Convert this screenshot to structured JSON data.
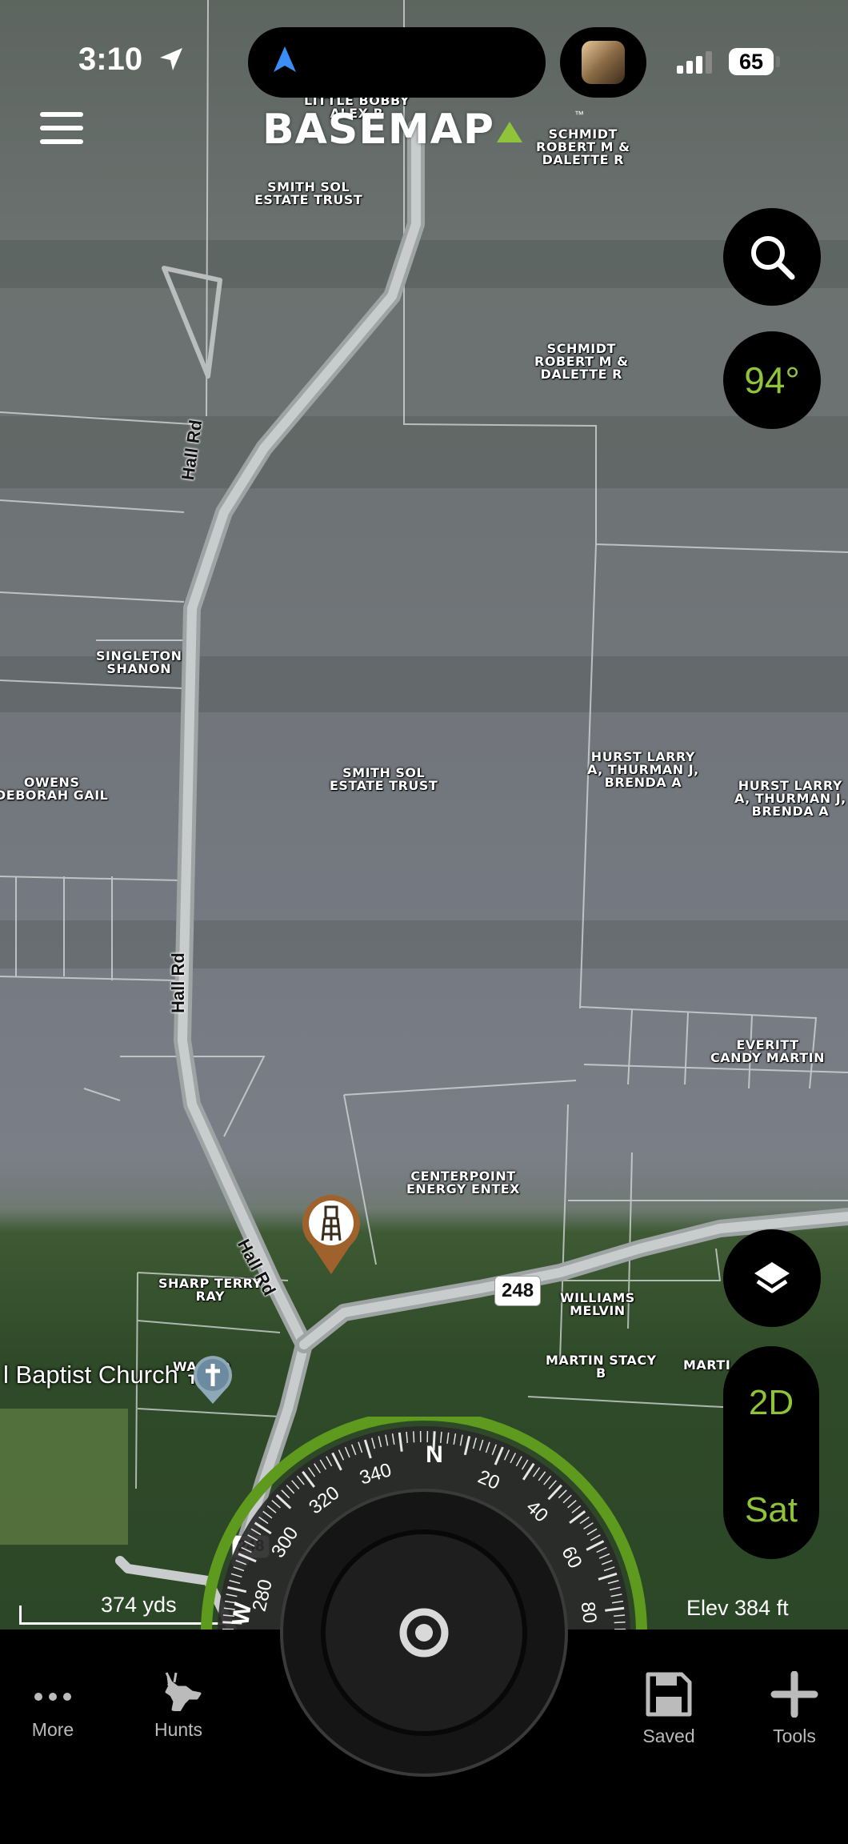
{
  "status_bar": {
    "time": "3:10",
    "battery": "65"
  },
  "header": {
    "logo_text": "BASEMAP",
    "logo_tm": "™"
  },
  "weather": {
    "temperature": "94°"
  },
  "map": {
    "roads": {
      "hall_rd_1": "Hall Rd",
      "hall_rd_2": "Hall Rd",
      "hall_rd_3": "Hall Rd",
      "route_248_a": "248",
      "route_248_b": "248"
    },
    "parcels": {
      "little_bobby": "LITTLE BOBBY\nALEX R",
      "schmidt_top": "SCHMIDT\nROBERT M &\nDALETTE R",
      "smith_top": "SMITH SOL\nESTATE TRUST",
      "schmidt_mid": "SCHMIDT\nROBERT M &\nDALETTE R",
      "singleton": "SINGLETON\nSHANON",
      "smith_mid": "SMITH SOL\nESTATE TRUST",
      "owens": "OWENS\nDEBORAH GAIL",
      "hurst_1": "HURST LARRY\nA, THURMAN J,\nBRENDA A",
      "hurst_2": "HURST LARRY\nA, THURMAN J,\nBRENDA A",
      "everitt": "EVERITT\nCANDY MARTIN",
      "centerpoint": "CENTERPOINT\nENERGY ENTEX",
      "sharp": "SHARP TERRY\nRAY",
      "williams": "WILLIAMS\nMELVIN",
      "martin_stacy": "MARTIN STACY\nB",
      "martin_cut": "MARTI",
      "wakefield": "WA        ELD\n            TAL"
    },
    "poi": {
      "church_label": "l Baptist Church"
    },
    "scale": "374 yds",
    "elevation": "Elev 384 ft"
  },
  "compass": {
    "heading_label": "N",
    "ticks": [
      "280",
      "300",
      "320",
      "340",
      "20",
      "40",
      "60",
      "80"
    ],
    "west_label": "W"
  },
  "view_toggle": {
    "mode_2d": "2D",
    "mode_sat": "Sat"
  },
  "bottom_nav": {
    "more": "More",
    "hunts": "Hunts",
    "saved": "Saved",
    "tools": "Tools"
  },
  "colors": {
    "accent_green": "#8fc43a",
    "pin_brown": "#a0622d",
    "bar_bg": "#000000"
  },
  "icons": [
    "location-arrow-icon",
    "navigation-icon",
    "signal-icon",
    "menu-icon",
    "search-icon",
    "layers-icon",
    "tree-stand-pin-icon",
    "church-icon",
    "more-dots-icon",
    "deer-icon",
    "save-disk-icon",
    "plus-icon",
    "target-icon"
  ]
}
